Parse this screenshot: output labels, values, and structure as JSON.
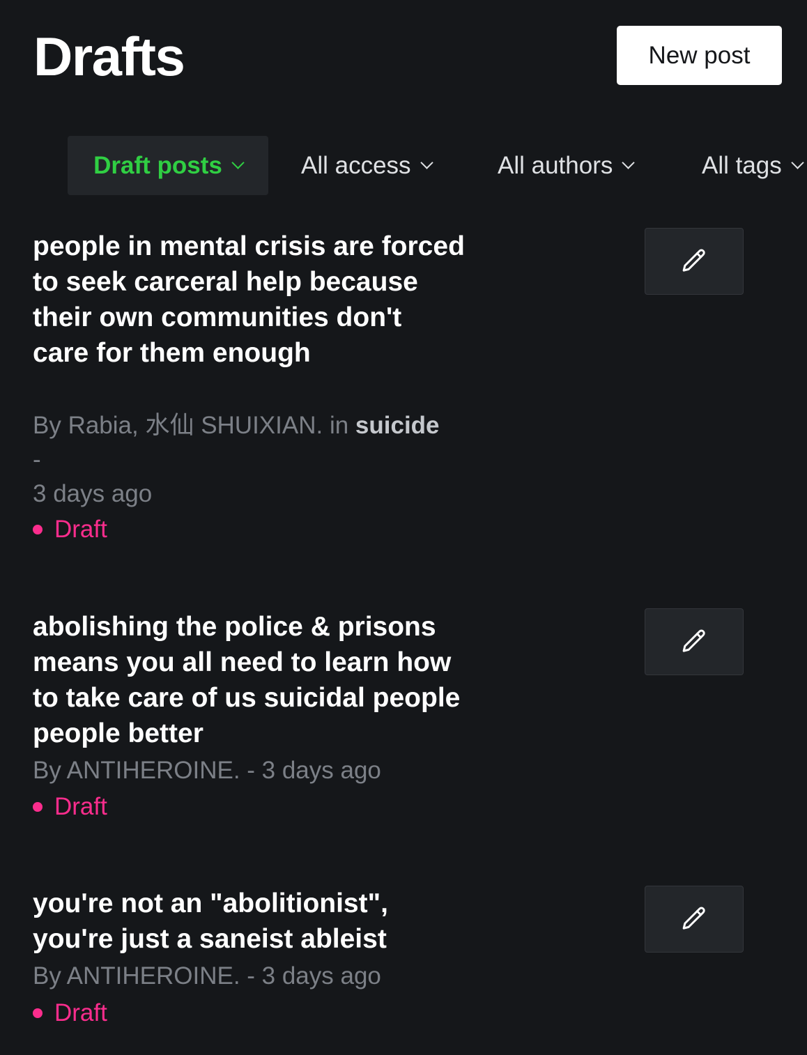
{
  "header": {
    "title": "Drafts",
    "new_post_label": "New post"
  },
  "filters": [
    {
      "label": "Draft posts",
      "active": true
    },
    {
      "label": "All access",
      "active": false
    },
    {
      "label": "All authors",
      "active": false
    },
    {
      "label": "All tags",
      "active": false
    }
  ],
  "posts": [
    {
      "title": "people in mental crisis are forced to seek carceral help because their own communities don't care for them enough",
      "byline": "By Rabia, 水仙 SHUIXIAN. in ",
      "tag": "suicide",
      "separator": "-",
      "time": "3 days ago",
      "status": "Draft",
      "edit_icon": "pencil-icon"
    },
    {
      "title": "abolishing the police & prisons means you all need to learn how to take care of us suicidal people people better",
      "meta": "By ANTIHEROINE. - 3 days ago",
      "status": "Draft",
      "edit_icon": "pencil-icon"
    },
    {
      "title": "you're not an \"abolitionist\", you're just a saneist ableist",
      "meta": "By ANTIHEROINE. - 3 days ago",
      "status": "Draft",
      "edit_icon": "pencil-icon"
    }
  ],
  "colors": {
    "background": "#15171a",
    "accent_green": "#30cf43",
    "draft_pink": "#fb2d8d",
    "muted_text": "#7c8087"
  }
}
